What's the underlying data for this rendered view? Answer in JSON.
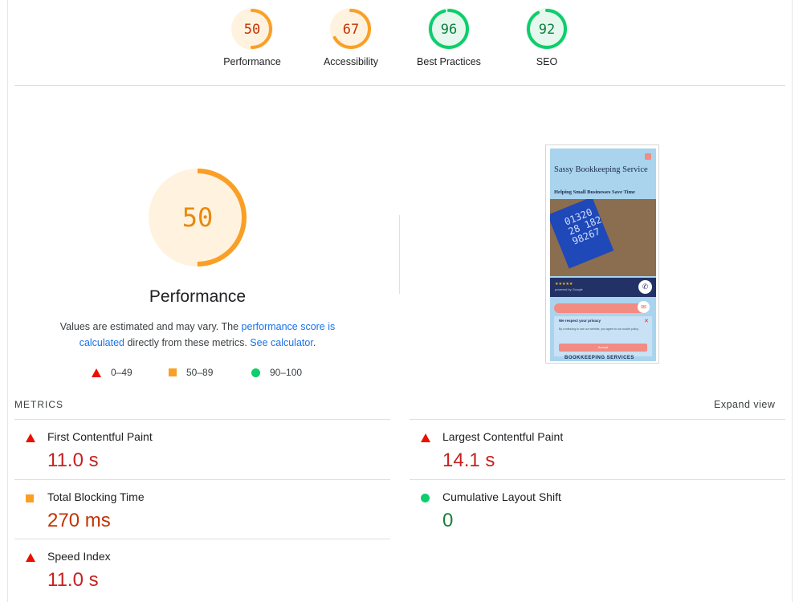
{
  "colors": {
    "fail": "#eb0f00",
    "average": "#fa9f26",
    "pass": "#0cce6b",
    "link": "#1a73e8"
  },
  "gauges": [
    {
      "score": "50",
      "label": "Performance",
      "value": 0.5,
      "status": "average"
    },
    {
      "score": "67",
      "label": "Accessibility",
      "value": 0.67,
      "status": "average"
    },
    {
      "score": "96",
      "label": "Best Practices",
      "value": 0.96,
      "status": "pass"
    },
    {
      "score": "92",
      "label": "SEO",
      "value": 0.92,
      "status": "pass"
    }
  ],
  "performance": {
    "score": "50",
    "value": 0.5,
    "title": "Performance",
    "desc_prefix": "Values are estimated and may vary. The ",
    "desc_link1": "performance score is calculated",
    "desc_middle": " directly from these metrics. ",
    "desc_link2": "See calculator",
    "desc_suffix": "."
  },
  "legend": [
    {
      "icon": "triangle-icon",
      "range": "0–49"
    },
    {
      "icon": "square-icon",
      "range": "50–89"
    },
    {
      "icon": "circle-icon",
      "range": "90–100"
    }
  ],
  "screenshot": {
    "title_line": "Sassy    Bookkeeping Service",
    "subtitle": "Helping Small Businesses Save Time",
    "calc_digits": "01320\n28 182\n98267",
    "stars": "★★★★★",
    "google": "powered by Google",
    "privacy_title": "We respect your privacy",
    "privacy_body": "By continuing to use our website, you agree to our cookie policy.",
    "privacy_button": "Accept",
    "bottom_text": "BOOKKEEPING SERVICES"
  },
  "metrics": {
    "header": "METRICS",
    "expand": "Expand view",
    "items": [
      {
        "name": "First Contentful Paint",
        "value": "11.0 s",
        "status": "fail"
      },
      {
        "name": "Largest Contentful Paint",
        "value": "14.1 s",
        "status": "fail"
      },
      {
        "name": "Total Blocking Time",
        "value": "270 ms",
        "status": "average"
      },
      {
        "name": "Cumulative Layout Shift",
        "value": "0",
        "status": "pass"
      },
      {
        "name": "Speed Index",
        "value": "11.0 s",
        "status": "fail"
      }
    ]
  }
}
